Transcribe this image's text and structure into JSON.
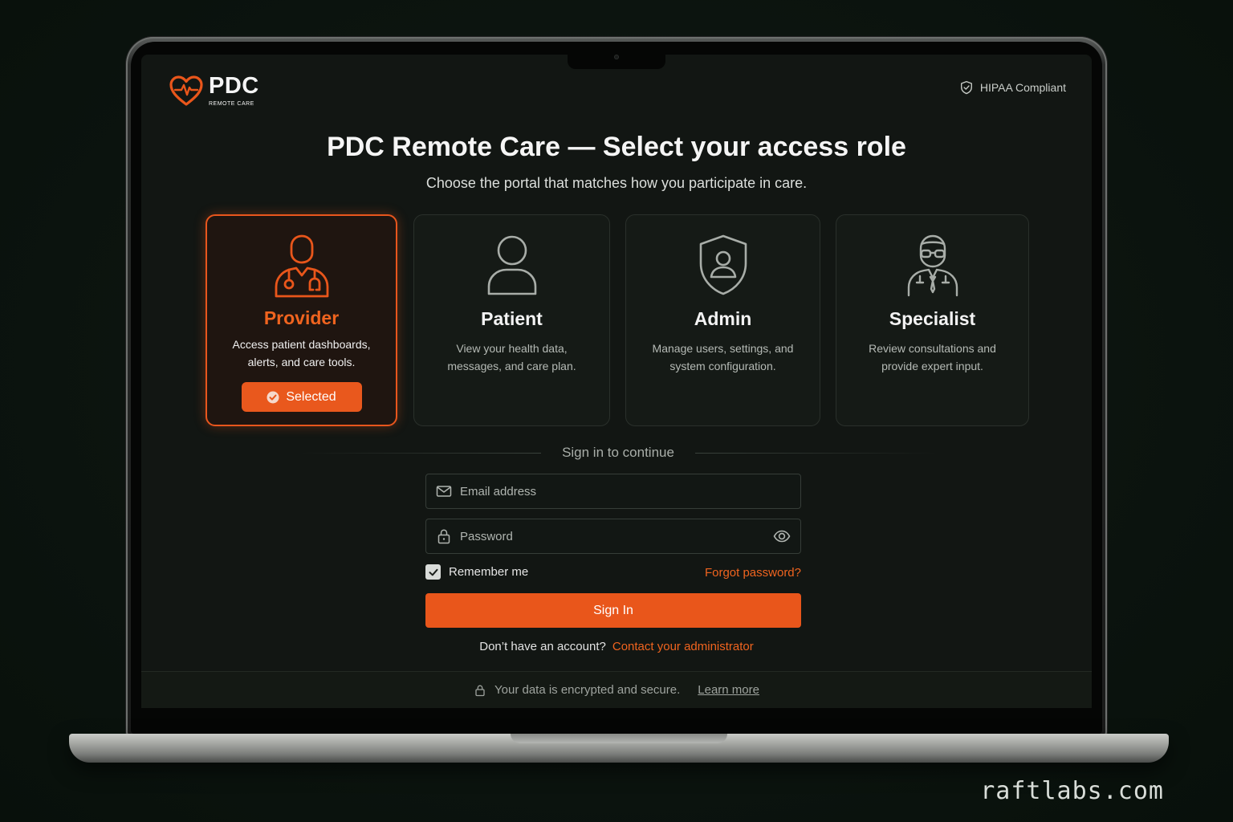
{
  "brand": {
    "name": "PDC",
    "tagline": "REMOTE CARE",
    "accent_color": "#e9561b",
    "logo_icon": "heart-pulse-icon"
  },
  "header": {
    "badge_label": "HIPAA Compliant",
    "badge_icon": "shield-check-icon"
  },
  "page": {
    "title": "PDC Remote Care — Select your access role",
    "subtitle": "Choose the portal that matches how you participate in care."
  },
  "roles": [
    {
      "name": "Provider",
      "description": "Access patient dashboards, alerts, and care tools.",
      "icon": "doctor-stethoscope-icon",
      "selected": true,
      "selected_label": "Selected"
    },
    {
      "name": "Patient",
      "description": "View your health data, messages, and care plan.",
      "icon": "user-icon",
      "selected": false
    },
    {
      "name": "Admin",
      "description": "Manage users, settings, and system configuration.",
      "icon": "shield-user-icon",
      "selected": false
    },
    {
      "name": "Specialist",
      "description": "Review consultations and provide expert input.",
      "icon": "specialist-glasses-icon",
      "selected": false
    }
  ],
  "signin": {
    "divider_text": "Sign in to continue",
    "email_placeholder": "Email address",
    "password_placeholder": "Password",
    "remember_label": "Remember me",
    "remember_checked": true,
    "forgot_label": "Forgot password?",
    "submit_label": "Sign In",
    "no_account_text": "Don’t have an account?",
    "contact_link": "Contact your administrator"
  },
  "footer": {
    "security_text": "Your data is encrypted and secure.",
    "learn_more": "Learn more"
  },
  "watermark": "raftlabs.com"
}
